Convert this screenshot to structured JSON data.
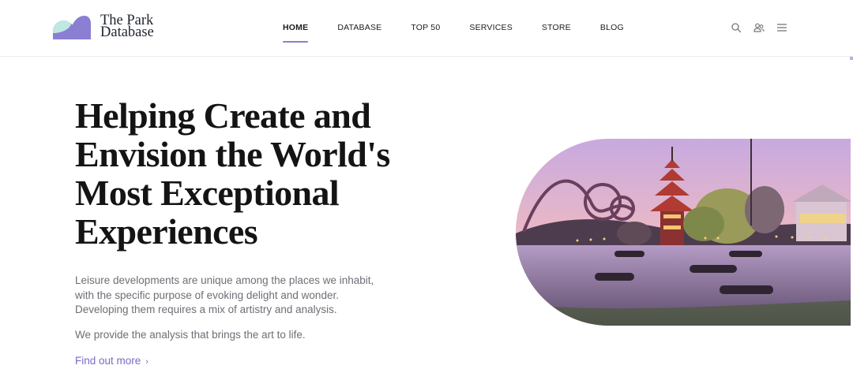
{
  "brand": {
    "name_line1": "The Park",
    "name_line2": "Database",
    "accent": "#8b7fd3",
    "logo_colors": [
      "#bfe8e2",
      "#8b7fd3"
    ]
  },
  "nav": {
    "items": [
      {
        "label": "HOME",
        "active": true
      },
      {
        "label": "DATABASE",
        "active": false
      },
      {
        "label": "TOP 50",
        "active": false
      },
      {
        "label": "SERVICES",
        "active": false
      },
      {
        "label": "STORE",
        "active": false
      },
      {
        "label": "BLOG",
        "active": false
      }
    ],
    "icons": [
      "search-icon",
      "user-group-icon",
      "menu-icon"
    ]
  },
  "hero": {
    "title_lines": [
      "Helping Create and",
      "Envision the World's",
      "Most Exceptional",
      "Experiences"
    ],
    "body_lines": [
      "Leisure developments are unique among the places we inhabit,",
      "with the specific purpose of evoking delight and wonder.",
      "Developing them requires a mix of artistry and analysis."
    ],
    "body2": "We provide the analysis that brings the art to life.",
    "cta": "Find out more",
    "cta_chevron": "›",
    "image": "amusement-park-pagoda-lake-photo"
  }
}
